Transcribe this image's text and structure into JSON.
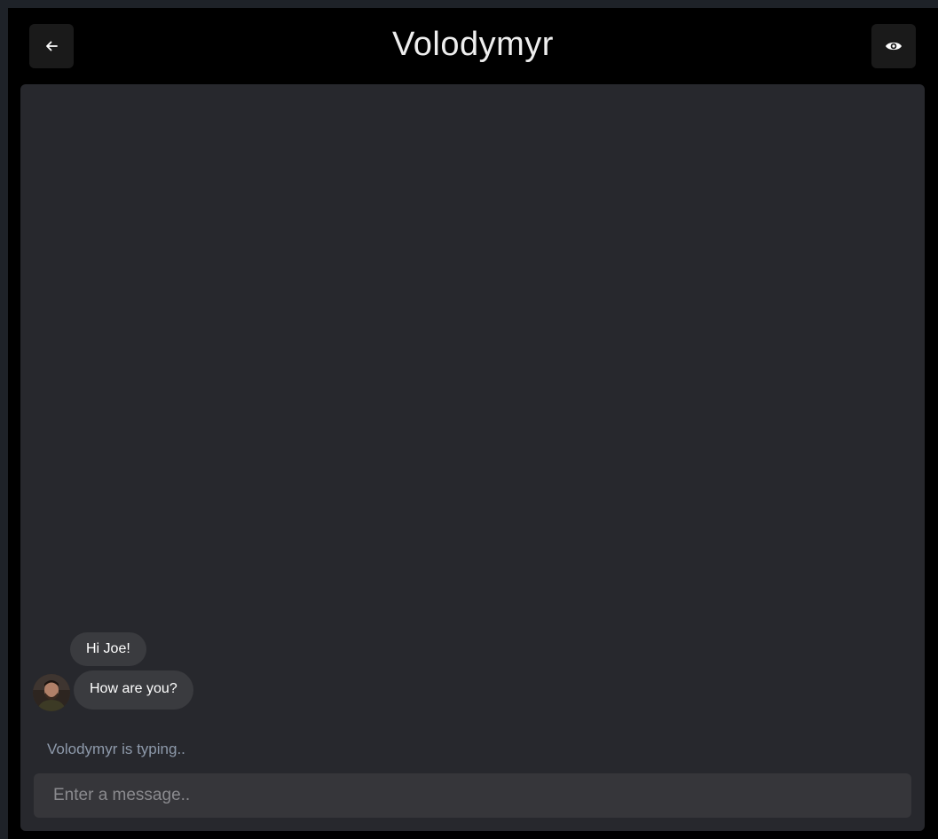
{
  "header": {
    "title": "Volodymyr",
    "back_icon": "arrow-left-icon",
    "view_icon": "eye-icon"
  },
  "messages": [
    {
      "text": "Hi Joe!"
    },
    {
      "text": "How are you?"
    }
  ],
  "typing_indicator": "Volodymyr is typing..",
  "composer": {
    "placeholder": "Enter a message.."
  },
  "colors": {
    "background": "#000000",
    "chat_panel": "#27282d",
    "bubble": "#3a3b3f",
    "typing_text": "#8e9aab"
  }
}
